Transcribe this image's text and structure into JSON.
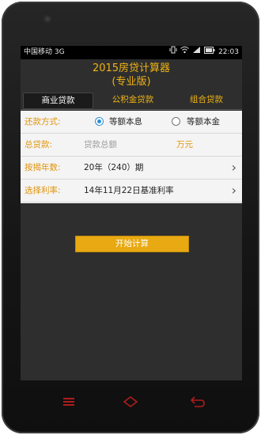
{
  "status_bar": {
    "carrier": "中国移动 3G",
    "time": "22:03"
  },
  "header": {
    "title_line1": "2015房贷计算器",
    "title_line2": "(专业版)"
  },
  "tabs": [
    {
      "label": "商业贷款",
      "active": true
    },
    {
      "label": "公积金贷款",
      "active": false
    },
    {
      "label": "组合贷款",
      "active": false
    }
  ],
  "form": {
    "repayment": {
      "label": "还款方式:",
      "options": [
        "等额本息",
        "等额本金"
      ],
      "selected": "等额本息"
    },
    "loan_total": {
      "label": "总贷款:",
      "placeholder": "贷款总额",
      "unit": "万元"
    },
    "term": {
      "label": "按揭年数:",
      "value": "20年（240）期"
    },
    "rate": {
      "label": "选择利率:",
      "value": "14年11月22日基准利率"
    }
  },
  "actions": {
    "start_label": "开始计算"
  },
  "colors": {
    "accent": "#f0b313",
    "label_orange": "#e0940b",
    "radio_blue": "#2d8fd8",
    "button": "#e8a912"
  },
  "icons": [
    "signal-icon",
    "wifi-icon",
    "battery-icon",
    "chevron-right-icon",
    "menu-icon",
    "home-icon",
    "back-icon"
  ]
}
